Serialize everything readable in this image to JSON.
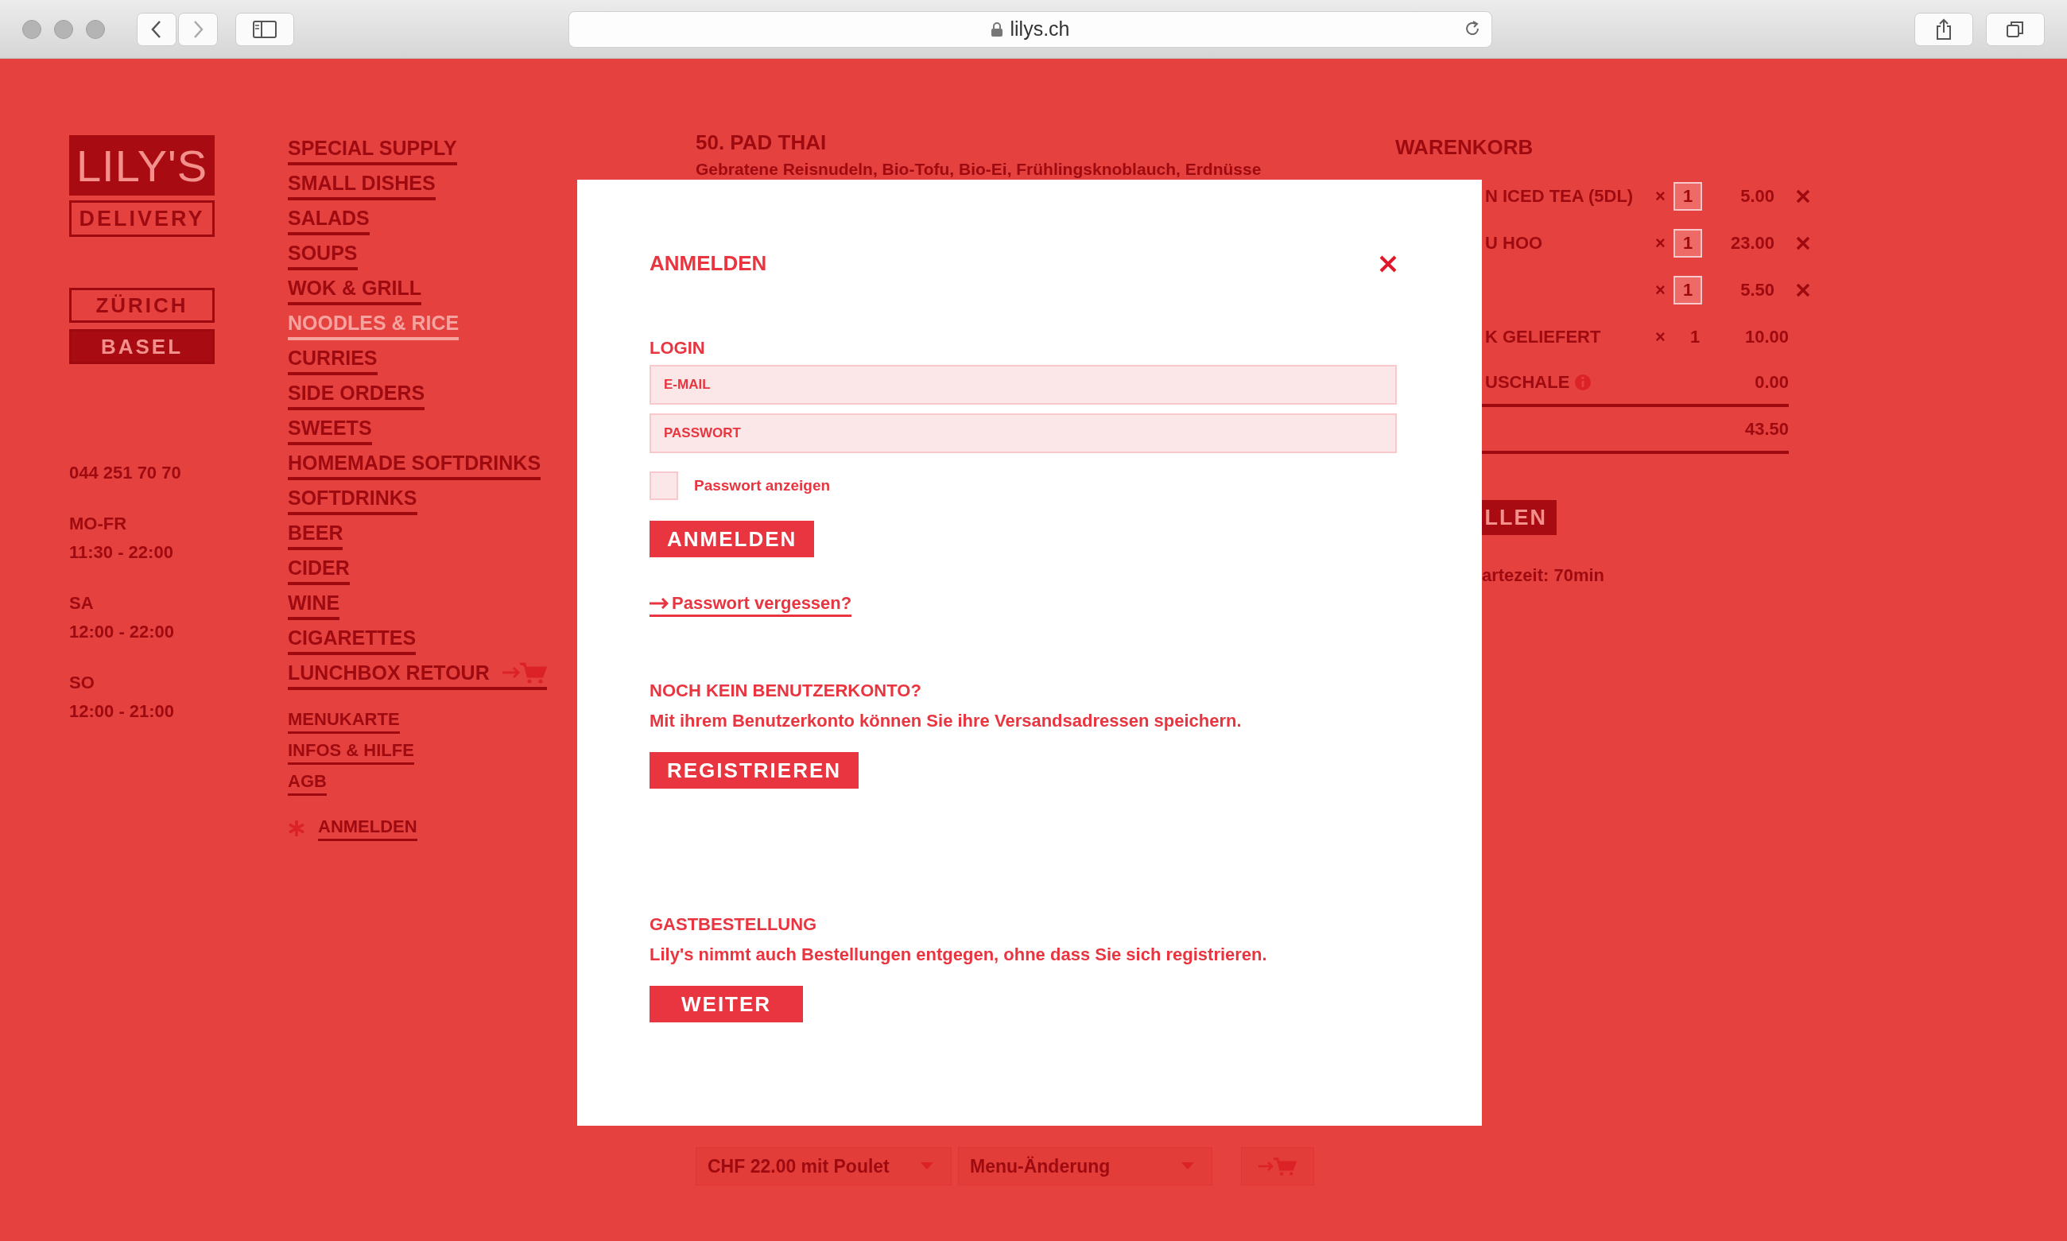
{
  "browser": {
    "url": "lilys.ch"
  },
  "brand": {
    "logo": "LILY'S",
    "tagline": "DELIVERY"
  },
  "cities": [
    {
      "label": "ZÜRICH",
      "selected": false
    },
    {
      "label": "BASEL",
      "selected": true
    }
  ],
  "contact": {
    "phone": "044 251 70 70",
    "hours": [
      {
        "days": "MO-FR",
        "time": "11:30 - 22:00"
      },
      {
        "days": "SA",
        "time": "12:00 - 22:00"
      },
      {
        "days": "SO",
        "time": "12:00 - 21:00"
      }
    ]
  },
  "categories": [
    {
      "label": "SPECIAL SUPPLY",
      "disabled": false
    },
    {
      "label": "SMALL DISHES",
      "disabled": false
    },
    {
      "label": "SALADS",
      "disabled": false
    },
    {
      "label": "SOUPS",
      "disabled": false
    },
    {
      "label": "WOK & GRILL",
      "disabled": false
    },
    {
      "label": "NOODLES & RICE",
      "disabled": true
    },
    {
      "label": "CURRIES",
      "disabled": false
    },
    {
      "label": "SIDE ORDERS",
      "disabled": false
    },
    {
      "label": "SWEETS",
      "disabled": false
    },
    {
      "label": "HOMEMADE SOFTDRINKS",
      "disabled": false
    },
    {
      "label": "SOFTDRINKS",
      "disabled": false
    },
    {
      "label": "BEER",
      "disabled": false
    },
    {
      "label": "CIDER",
      "disabled": false
    },
    {
      "label": "WINE",
      "disabled": false
    },
    {
      "label": "CIGARETTES",
      "disabled": false
    }
  ],
  "lunchbox_link": "LUNCHBOX RETOUR",
  "info_links": [
    "MENUKARTE",
    "INFOS & HILFE",
    "AGB"
  ],
  "account_link": "ANMELDEN",
  "dish": {
    "title": "50. PAD THAI",
    "description": "Gebratene Reisnudeln, Bio-Tofu, Bio-Ei, Frühlingsknoblauch, Erdnüsse",
    "price_select": "CHF 22.00 mit Poulet",
    "option_select": "Menu-Änderung"
  },
  "cart": {
    "title": "WARENKORB",
    "items": [
      {
        "name": "N ICED TEA (5DL)",
        "multiplier": "×",
        "quantity": "1",
        "editable": true,
        "price": "5.00",
        "removable": true
      },
      {
        "name": "U HOO",
        "multiplier": "×",
        "quantity": "1",
        "editable": true,
        "price": "23.00",
        "removable": true
      },
      {
        "multiplier": "×",
        "quantity": "1",
        "editable": true,
        "price": "5.50",
        "removable": true
      },
      {
        "name": "K GELIEFERT",
        "multiplier": "×",
        "quantity": "1",
        "editable": false,
        "price": "10.00",
        "removable": false
      }
    ],
    "deposit": {
      "label": "USCHALE",
      "price": "0.00"
    },
    "total": "43.50",
    "order_button": "LLEN",
    "wait_time": "artezeit: 70min"
  },
  "modal": {
    "title": "ANMELDEN",
    "login": {
      "heading": "LOGIN",
      "email_placeholder": "E-MAIL",
      "password_placeholder": "PASSWORT",
      "show_password": {
        "label": "Passwort anzeigen",
        "checked": false
      },
      "submit": "ANMELDEN",
      "forgot_link": "Passwort vergessen?"
    },
    "register": {
      "heading": "NOCH KEIN BENUTZERKONTO?",
      "text": "Mit ihrem Benutzerkonto können Sie ihre Versandsadressen speichern.",
      "button": "REGISTRIEREN"
    },
    "guest": {
      "heading": "GASTBESTELLUNG",
      "text": "Lily's nimmt auch Bestellungen entgegen, ohne dass Sie sich registrieren.",
      "button": "WEITER"
    }
  }
}
